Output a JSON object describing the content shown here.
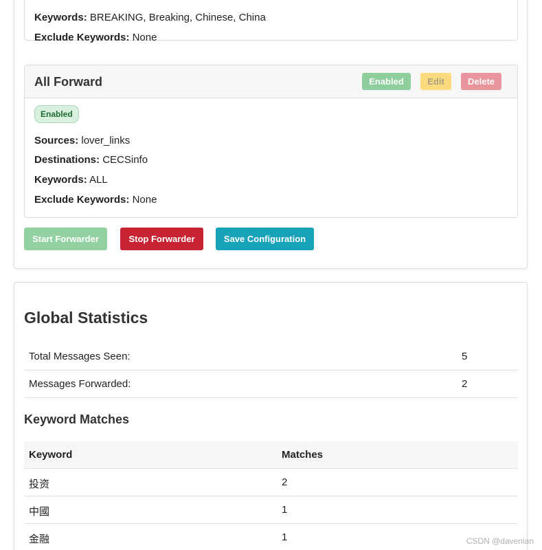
{
  "rules": [
    {
      "keywords_label": "Keywords:",
      "keywords": "BREAKING, Breaking, Chinese, China",
      "exclude_label": "Exclude Keywords:",
      "exclude": "None"
    },
    {
      "title": "All Forward",
      "buttons": {
        "enabled": "Enabled",
        "edit": "Edit",
        "delete": "Delete"
      },
      "status_badge": "Enabled",
      "sources_label": "Sources:",
      "sources": "lover_links",
      "destinations_label": "Destinations:",
      "destinations": "CECSinfo",
      "keywords_label": "Keywords:",
      "keywords": "ALL",
      "exclude_label": "Exclude Keywords:",
      "exclude": "None"
    }
  ],
  "actions": {
    "start": "Start Forwarder",
    "stop": "Stop Forwarder",
    "save": "Save Configuration"
  },
  "stats": {
    "title": "Global Statistics",
    "rows": [
      {
        "label": "Total Messages Seen:",
        "value": "5"
      },
      {
        "label": "Messages Forwarded:",
        "value": "2"
      }
    ],
    "keyword_title": "Keyword Matches",
    "keyword_headers": {
      "keyword": "Keyword",
      "matches": "Matches"
    },
    "keyword_rows": [
      {
        "keyword": "投资",
        "matches": "2"
      },
      {
        "keyword": "中國",
        "matches": "1"
      },
      {
        "keyword": "金融",
        "matches": "1"
      }
    ]
  },
  "watermark": "CSDN @davenian",
  "colors": {
    "success": "#28a745",
    "warning": "#ffc107",
    "danger": "#dc3545",
    "info": "#17a2b8",
    "stop_button": "#c82333"
  }
}
